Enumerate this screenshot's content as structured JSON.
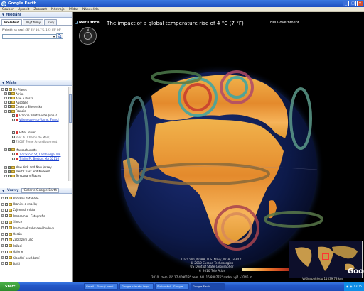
{
  "window": {
    "title": "Google Earth"
  },
  "menu": [
    "Soubor",
    "Upravit",
    "Zobrazit",
    "Nástroje",
    "Přidat",
    "Nápověda"
  ],
  "search": {
    "header": "Hledání",
    "tabs": [
      "Přeletout",
      "Najít firmy",
      "Trasy"
    ],
    "hint": "Přeletět na např.: 37 25' 16.7'S, 122 05' 06'",
    "input_value": ""
  },
  "places": {
    "header": "Místa",
    "items": [
      {
        "label": "My Places",
        "kind": "folder"
      },
      {
        "label": "Afrika",
        "kind": "folder"
      },
      {
        "label": "Asie a Rusko",
        "kind": "folder"
      },
      {
        "label": "Austrálie",
        "kind": "folder"
      },
      {
        "label": "Česko a Slovensko",
        "kind": "folder"
      },
      {
        "label": "Francie",
        "kind": "folder"
      },
      {
        "label": "Francie Villefranche June 2...",
        "kind": "placemark"
      },
      {
        "label": "Villeneuve-sur-Yonne, Franci",
        "kind": "link"
      },
      {
        "label": "",
        "kind": "blank"
      },
      {
        "label": "",
        "kind": "blank"
      },
      {
        "label": "Eiffel Tower",
        "kind": "placemark"
      },
      {
        "label": "Parc du Champ de Mars,",
        "kind": "muted"
      },
      {
        "label": "75007 7eme Arrondissement",
        "kind": "muted"
      },
      {
        "label": "",
        "kind": "blank"
      },
      {
        "label": "Massachusetts",
        "kind": "folder"
      },
      {
        "label": "17 Oxford St, Cambridge, MA",
        "kind": "link"
      },
      {
        "label": "Trinity Pl, Boston, MA 02116",
        "kind": "link"
      },
      {
        "label": "",
        "kind": "blank"
      },
      {
        "label": "New York and New Jersey",
        "kind": "folder"
      },
      {
        "label": "West Coast and Midwest",
        "kind": "folder"
      },
      {
        "label": "Temporary Places",
        "kind": "folder"
      }
    ]
  },
  "layers": {
    "tabs": [
      "Vrstvy",
      "Galerie Google Earth"
    ],
    "items": [
      "Primární databáze",
      "Hranice a značky",
      "Zajímavá místa",
      "Panoramio - Fotografie",
      "Silnice",
      "Prostorové zobrazení budovy",
      "Oceán",
      "Zobrazení ulic",
      "Počasí",
      "Galerie",
      "Globální povědomí",
      "Další"
    ]
  },
  "map": {
    "banner_left": "Met Office",
    "headline": "The impact of a global temperature rise of 4 °C (7 °F)",
    "banner_right": "HM Government",
    "credits": [
      "Data SIO, NOAA, U.S. Navy, NGA, GEBCO",
      "© 2010 Europa Technologies",
      "US Dept of State Geographer",
      "© 2010 Tele Atlas"
    ],
    "status_left": "2010",
    "status_mid": "zem. šíř.  17.409018°   zem. dél.  16.888776°   nadm. výš. -3246 m",
    "status_right": "Výška pohledu 11039.73 km",
    "google_logo": "Google",
    "nav_n": "N"
  },
  "taskbar": {
    "start": "Start",
    "tasks": [
      "Gmail - Sleduji pravi...",
      "Google climate impa...",
      "Stahování - Google...",
      "Google Earth"
    ],
    "clock": "13:15"
  }
}
